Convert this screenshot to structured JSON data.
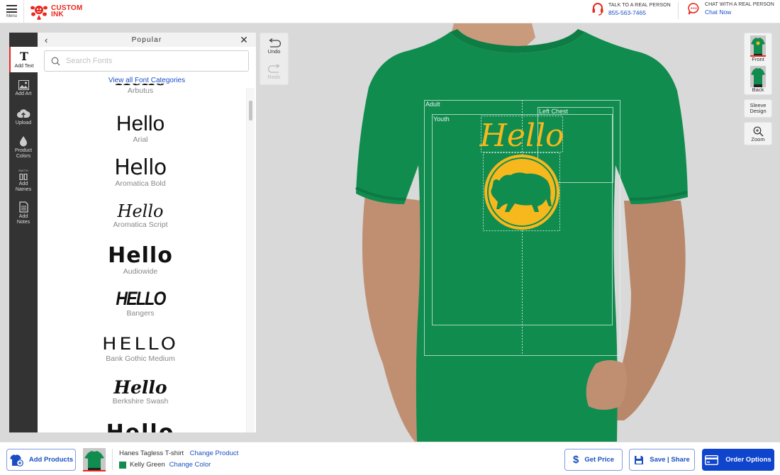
{
  "header": {
    "menu_label": "Menu",
    "logo_line1": "CUSTOM",
    "logo_line2": "INK",
    "phone": {
      "caption": "TALK TO A REAL PERSON",
      "number": "855-563-7465"
    },
    "chat": {
      "caption": "CHAT WITH A REAL PERSON",
      "link": "Chat Now"
    }
  },
  "rail": {
    "items": [
      {
        "label_line1": "Add Text",
        "label_line2": "",
        "icon": "text-icon",
        "active": true
      },
      {
        "label_line1": "Add Art",
        "label_line2": "",
        "icon": "image-icon"
      },
      {
        "label_line1": "Upload",
        "label_line2": "",
        "icon": "cloud-upload-icon"
      },
      {
        "label_line1": "Product",
        "label_line2": "Colors",
        "icon": "drop-icon"
      },
      {
        "label_line1": "Add",
        "label_line2": "Names",
        "icon": "jersey-names-icon",
        "icon_text": "SMITH"
      },
      {
        "label_line1": "Add",
        "label_line2": "Notes",
        "icon": "notes-icon"
      }
    ]
  },
  "font_panel": {
    "title": "Popular",
    "search_placeholder": "Search Fonts",
    "view_all_label": "View all Font Categories",
    "sample_text": "Hello",
    "fonts": [
      {
        "name": "Arbutus",
        "sample": "Hello",
        "partial": true
      },
      {
        "name": "Arial",
        "sample": "Hello"
      },
      {
        "name": "Aromatica Bold",
        "sample": "Hello"
      },
      {
        "name": "Aromatica Script",
        "sample": "Hello"
      },
      {
        "name": "Audiowide",
        "sample": "Hello"
      },
      {
        "name": "Bangers",
        "sample": "HELLO"
      },
      {
        "name": "Bank Gothic Medium",
        "sample": "HELLO"
      },
      {
        "name": "Berkshire Swash",
        "sample": "Hello"
      },
      {
        "name": "",
        "sample": "Hello",
        "partial": true
      }
    ]
  },
  "history": {
    "undo_label": "Undo",
    "redo_label": "Redo"
  },
  "design": {
    "text": "Hello",
    "art": "bison-in-circle",
    "print_areas": {
      "adult": "Adult",
      "youth": "Youth",
      "left_chest": "Left Chest"
    },
    "colors": {
      "shirt": "#118c4f",
      "ink": "#f7b81d",
      "guides": "#e6f3ec"
    }
  },
  "views": {
    "front_label": "Front",
    "back_label": "Back",
    "sleeve_label_line1": "Sleeve",
    "sleeve_label_line2": "Design",
    "zoom_label": "Zoom"
  },
  "footer": {
    "add_products_label": "Add Products",
    "product_name": "Hanes Tagless T-shirt",
    "change_product_label": "Change Product",
    "color_name": "Kelly Green",
    "change_color_label": "Change Color",
    "get_price_label": "Get Price",
    "save_share_label": "Save | Share",
    "order_options_label": "Order Options"
  },
  "theme": {
    "brand_red": "#e8281e",
    "link_blue": "#1a4fc4",
    "primary_blue": "#0f44cc",
    "rail_dark": "#333333"
  }
}
